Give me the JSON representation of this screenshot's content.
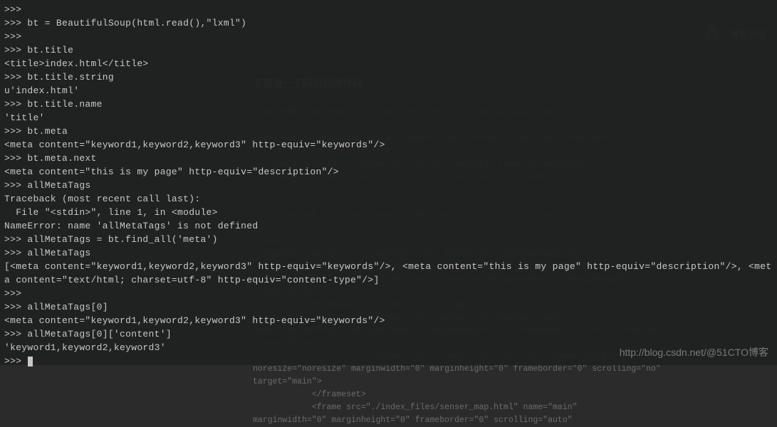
{
  "background": {
    "header_right": {
      "blog_manage": "博客管理"
    },
    "section_title": "下面看一下网页的源代码:",
    "dots": "...",
    "code": "<!DOCTYPE html PUBLIC \"-//W3C//DTD HTML 4.01 Transitional//EN\"\n|\n<html><head><meta http-equiv=\"Content-Type\" content=\"text/html; charset=UTF-8\">\n    <title>index.html</title>\n    <meta http-equiv=\"keywords\" content=\"keyword1,keyword2,keyword3\">\n    <meta http-equiv=\"description\" content=\"this is my page\">\n\n\n    <!--<link rel=\"stylesheet\" type=\"text/css\" href=\"./styles.css\">-->\n\n</head>\n<frameset rows=\"64,*\" frameborder=\"NO\" border=\"0\" framespacing=\"0\">\n            <frame src=\"./index_files/admin_top.html\" noresize=\"noresize\"\nframeborder=\"NO\" name=\"topFrame\" scrolling=\"no\" marginwidth=\"0\" marginheight=\"0\"\ntarget=\"main\">\n            <frameset cols=\"200,*\" id=\"frame\">\n                        <frame src=\"./index_files/message.html\"\nnoresize=\"noresize\" marginwidth=\"0\" marginheight=\"0\" frameborder=\"0\" scrolling=\"no\"\ntarget=\"main\">\n                        <frame src=\"./index_files/left.html\" name=\"leftFrame\"\nnoresize=\"noresize\" marginwidth=\"0\" marginheight=\"0\" frameborder=\"0\" scrolling=\"no\"\ntarget=\"main\">\n            </frameset>\n            <frame src=\"./index_files/senser_map.html\" name=\"main\"\nmarginwidth=\"0\" marginheight=\"0\" frameborder=\"0\" scrolling=\"auto\""
  },
  "terminal": {
    "lines": [
      ">>> ",
      ">>> bt = BeautifulSoup(html.read(),\"lxml\")",
      ">>> ",
      ">>> bt.title",
      "<title>index.html</title>",
      ">>> bt.title.string",
      "u'index.html'",
      ">>> bt.title.name",
      "'title'",
      ">>> bt.meta",
      "<meta content=\"keyword1,keyword2,keyword3\" http-equiv=\"keywords\"/>",
      ">>> bt.meta.next",
      "<meta content=\"this is my page\" http-equiv=\"description\"/>",
      ">>> allMetaTags",
      "Traceback (most recent call last):",
      "  File \"<stdin>\", line 1, in <module>",
      "NameError: name 'allMetaTags' is not defined",
      ">>> allMetaTags = bt.find_all('meta')",
      ">>> allMetaTags",
      "[<meta content=\"keyword1,keyword2,keyword3\" http-equiv=\"keywords\"/>, <meta content=\"this is my page\" http-equiv=\"description\"/>, <meta content=\"text/html; charset=utf-8\" http-equiv=\"content-type\"/>]",
      ">>> ",
      ">>> allMetaTags[0]",
      "<meta content=\"keyword1,keyword2,keyword3\" http-equiv=\"keywords\"/>",
      ">>> allMetaTags[0]['content']",
      "'keyword1,keyword2,keyword3'",
      ">>> "
    ]
  },
  "watermark": "http://blog.csdn.net/@51CTO博客"
}
